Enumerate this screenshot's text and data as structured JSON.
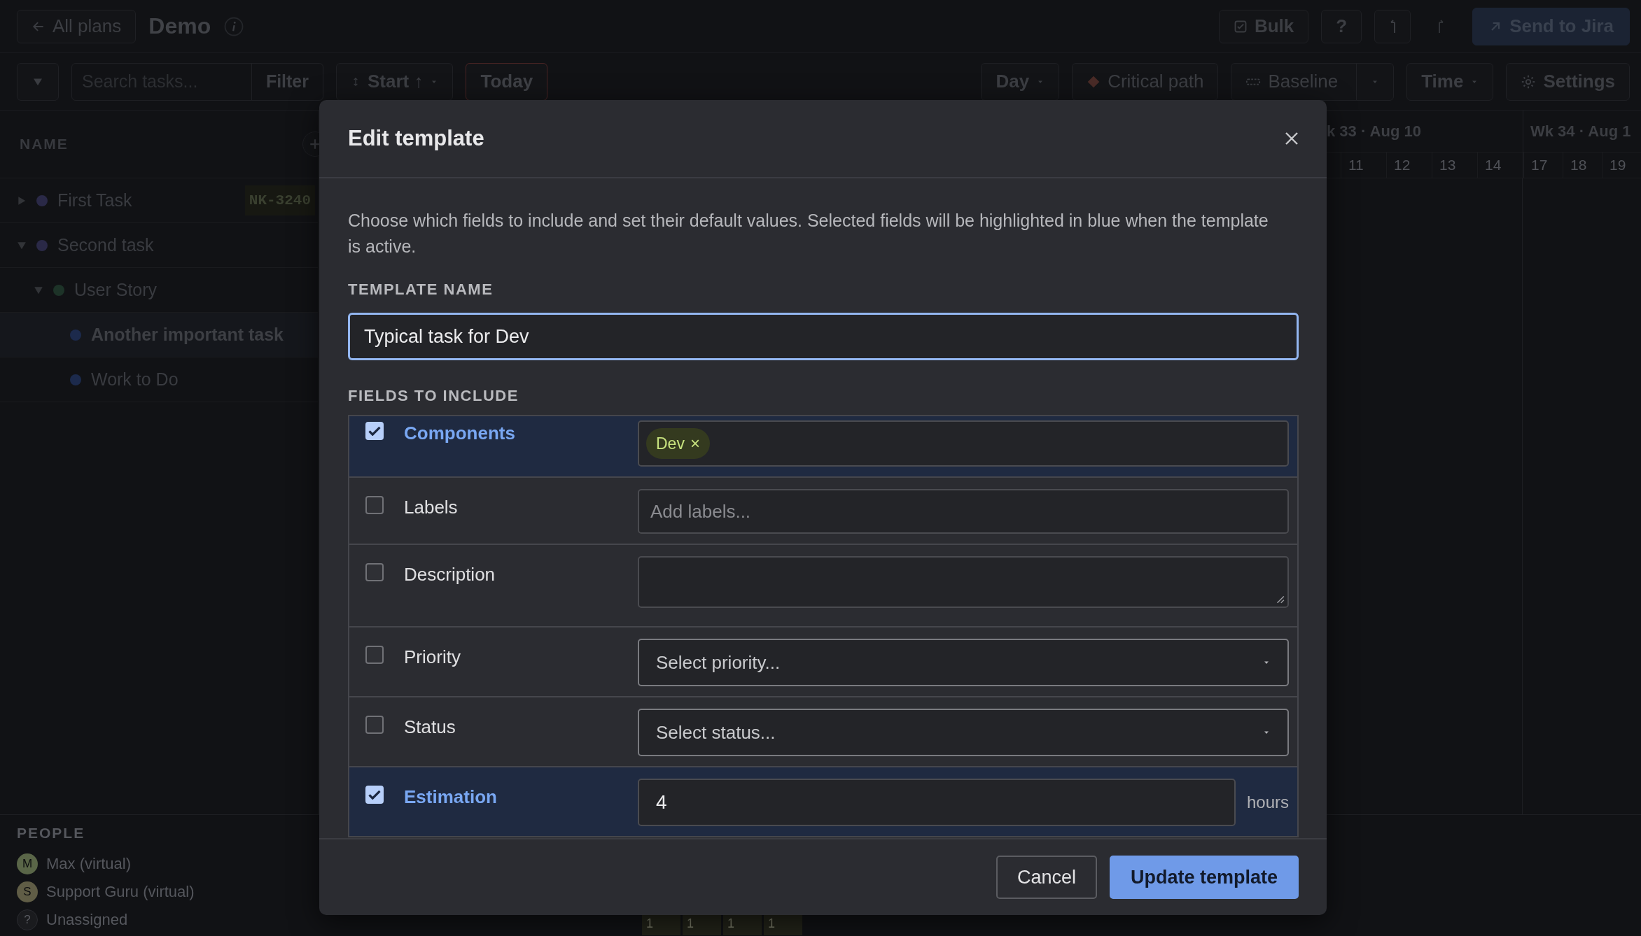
{
  "header": {
    "back_button": "All plans",
    "plan_title": "Demo",
    "actions": [
      {
        "kind": "bulk",
        "label": "Bulk"
      },
      {
        "kind": "help",
        "label": "?"
      },
      {
        "kind": "undo"
      },
      {
        "kind": "redo"
      },
      {
        "kind": "send",
        "label": "Send to Jira"
      }
    ]
  },
  "toolbar": {
    "search": {
      "placeholder": "Search tasks..."
    },
    "filter_button": "Filter",
    "sort_button": "Start ↑",
    "today_button": "Today",
    "controls": [
      {
        "kind": "dropdown",
        "label": "Day"
      },
      {
        "kind": "critical",
        "label": "Critical path"
      },
      {
        "kind": "split",
        "label": "Baseline"
      },
      {
        "kind": "dropdown",
        "label": "Time"
      },
      {
        "kind": "settings",
        "label": "Settings"
      }
    ]
  },
  "task_list": {
    "column_header": "NAME",
    "tasks": [
      {
        "name": "First Task",
        "color": "#2a2947",
        "expanded": false,
        "selected": false,
        "key": "NK-3240"
      },
      {
        "name": "Second task",
        "color": "#2a2947",
        "expanded": true,
        "selected": false,
        "children": [
          {
            "name": "User Story",
            "color": "#1d3328",
            "expanded": true,
            "selected": false,
            "children": [
              {
                "name": "Another important task",
                "color": "#1c2a4c",
                "selected": true
              },
              {
                "name": "Work to Do",
                "color": "#1c2a4c",
                "selected": false
              }
            ]
          }
        ]
      }
    ]
  },
  "timeline": {
    "weeks": [
      {
        "label": "k 33 · Aug 10",
        "days": [
          "11",
          "12",
          "13",
          "14"
        ]
      },
      {
        "label": "Wk 34 · Aug 1",
        "days": [
          "17",
          "18",
          "19"
        ]
      }
    ],
    "capacity_cells": [
      "1",
      "1",
      "1",
      "1"
    ]
  },
  "people": {
    "title": "PEOPLE",
    "items": [
      {
        "initial": "M",
        "name": "Max (virtual)",
        "color": "#5a6648"
      },
      {
        "initial": "S",
        "name": "Support Guru (virtual)",
        "color": "#605d46"
      },
      {
        "initial": "?",
        "name": "Unassigned",
        "color": "#1a1b1e"
      }
    ]
  },
  "modal": {
    "title": "Edit template",
    "description": "Choose which fields to include and set their default values. Selected fields will be highlighted in blue when the template is active.",
    "name_label": "TEMPLATE NAME",
    "name_value": "Typical task for Dev",
    "fields_label": "FIELDS TO INCLUDE",
    "fields": [
      {
        "label": "Components",
        "checked": true,
        "kind": "tags",
        "tags": [
          {
            "label": "Dev",
            "remove": "×"
          }
        ]
      },
      {
        "label": "Labels",
        "checked": false,
        "kind": "text",
        "placeholder": "Add labels..."
      },
      {
        "label": "Description",
        "checked": false,
        "kind": "textarea"
      },
      {
        "label": "Priority",
        "checked": false,
        "kind": "select",
        "placeholder": "Select priority..."
      },
      {
        "label": "Status",
        "checked": false,
        "kind": "select",
        "placeholder": "Select status..."
      },
      {
        "label": "Estimation",
        "checked": true,
        "kind": "number",
        "value": "4",
        "unit": "hours"
      }
    ],
    "buttons": [
      {
        "kind": "secondary",
        "label": "Cancel"
      },
      {
        "kind": "primary",
        "label": "Update template"
      }
    ]
  }
}
